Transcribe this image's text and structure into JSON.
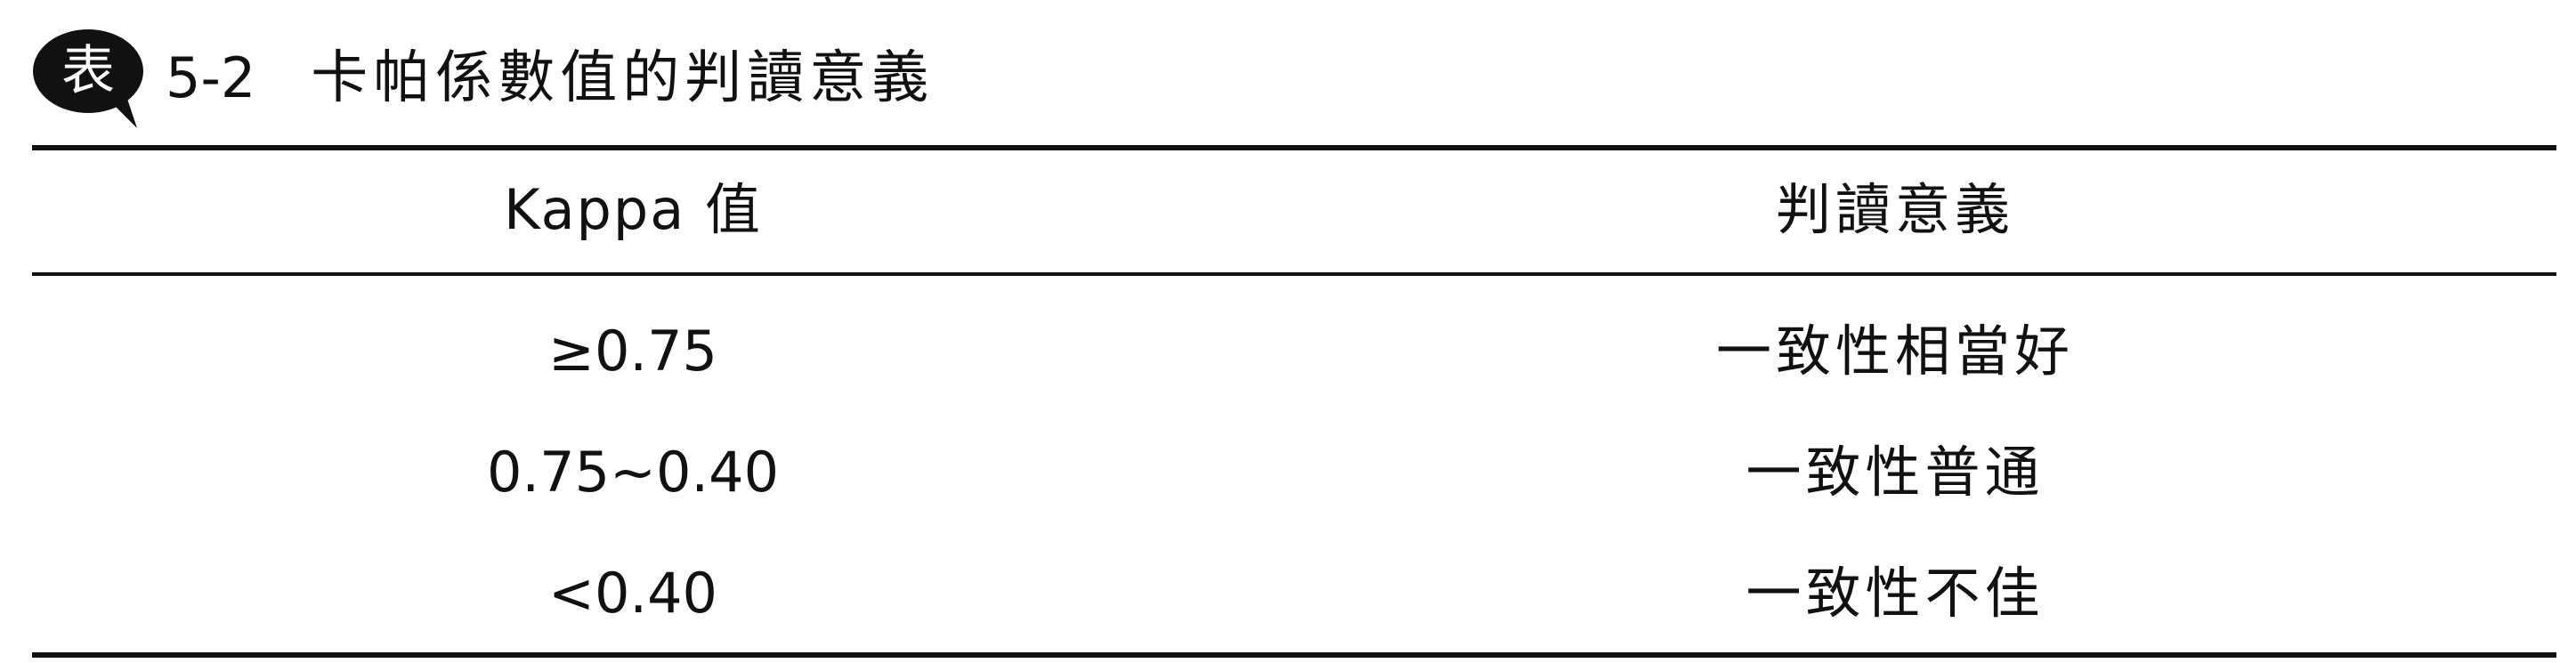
{
  "caption": {
    "badge": "表",
    "number": "5-2",
    "title": "卡帕係數值的判讀意義"
  },
  "table": {
    "headers": [
      "Kappa 值",
      "判讀意義"
    ],
    "rows": [
      [
        "≥0.75",
        "一致性相當好"
      ],
      [
        "0.75~0.40",
        "一致性普通"
      ],
      [
        "<0.40",
        "一致性不佳"
      ]
    ]
  },
  "colors": {
    "text": "#111111",
    "badge": "#111111",
    "background": "#ffffff"
  }
}
